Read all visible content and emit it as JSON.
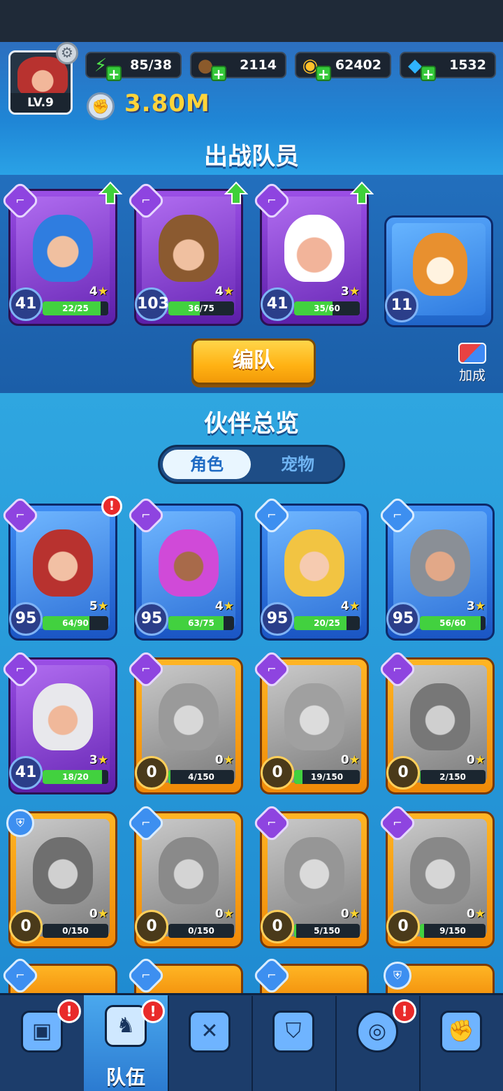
{
  "player": {
    "level": "LV.9",
    "power": "3.80M"
  },
  "resources": [
    {
      "name": "energy",
      "icon": "energy-icon",
      "value": "85/38"
    },
    {
      "name": "exp-food",
      "icon": "exp-bowl-icon",
      "value": "2114"
    },
    {
      "name": "coins",
      "icon": "coin-icon",
      "value": "62402"
    },
    {
      "name": "gems",
      "icon": "gem-icon",
      "value": "1532"
    }
  ],
  "team": {
    "title": "出战队员",
    "formation_label": "编队",
    "bonus_label": "加成",
    "members": [
      {
        "level": "41",
        "stars": "4",
        "xp": "22/25",
        "progress": 0.88,
        "upgrade": true
      },
      {
        "level": "103",
        "stars": "4",
        "xp": "36/75",
        "progress": 0.48,
        "upgrade": true
      },
      {
        "level": "41",
        "stars": "3",
        "xp": "35/60",
        "progress": 0.58,
        "upgrade": true
      },
      {
        "level": "11",
        "pet": true
      }
    ]
  },
  "overview": {
    "title": "伙伴总览",
    "tabs": {
      "roles": "角色",
      "pets": "宠物"
    },
    "cards": [
      {
        "level": "95",
        "stars": "5",
        "xp": "64/90",
        "progress": 0.71,
        "alert": "!"
      },
      {
        "level": "95",
        "stars": "4",
        "xp": "63/75",
        "progress": 0.84
      },
      {
        "level": "95",
        "stars": "4",
        "xp": "20/25",
        "progress": 0.8
      },
      {
        "level": "95",
        "stars": "3",
        "xp": "56/60",
        "progress": 0.93
      },
      {
        "level": "41",
        "stars": "3",
        "xp": "18/20",
        "progress": 0.9
      },
      {
        "level": "0",
        "stars": "0",
        "xp": "4/150",
        "progress": 0.03
      },
      {
        "level": "0",
        "stars": "0",
        "xp": "19/150",
        "progress": 0.13
      },
      {
        "level": "0",
        "stars": "0",
        "xp": "2/150",
        "progress": 0.01
      },
      {
        "level": "0",
        "stars": "0",
        "xp": "0/150",
        "progress": 0
      },
      {
        "level": "0",
        "stars": "0",
        "xp": "0/150",
        "progress": 0
      },
      {
        "level": "0",
        "stars": "0",
        "xp": "5/150",
        "progress": 0.03
      },
      {
        "level": "0",
        "stars": "0",
        "xp": "9/150",
        "progress": 0.06
      }
    ]
  },
  "nav": {
    "items": [
      {
        "icon": "tv-icon",
        "label": "",
        "badge": "!"
      },
      {
        "icon": "team-icon",
        "label": "队伍",
        "badge": "!",
        "active": true
      },
      {
        "icon": "map-icon",
        "label": ""
      },
      {
        "icon": "shield-helmet-icon",
        "label": ""
      },
      {
        "icon": "target-icon",
        "label": "",
        "badge": "!"
      },
      {
        "icon": "guild-shield-icon",
        "label": ""
      }
    ]
  }
}
